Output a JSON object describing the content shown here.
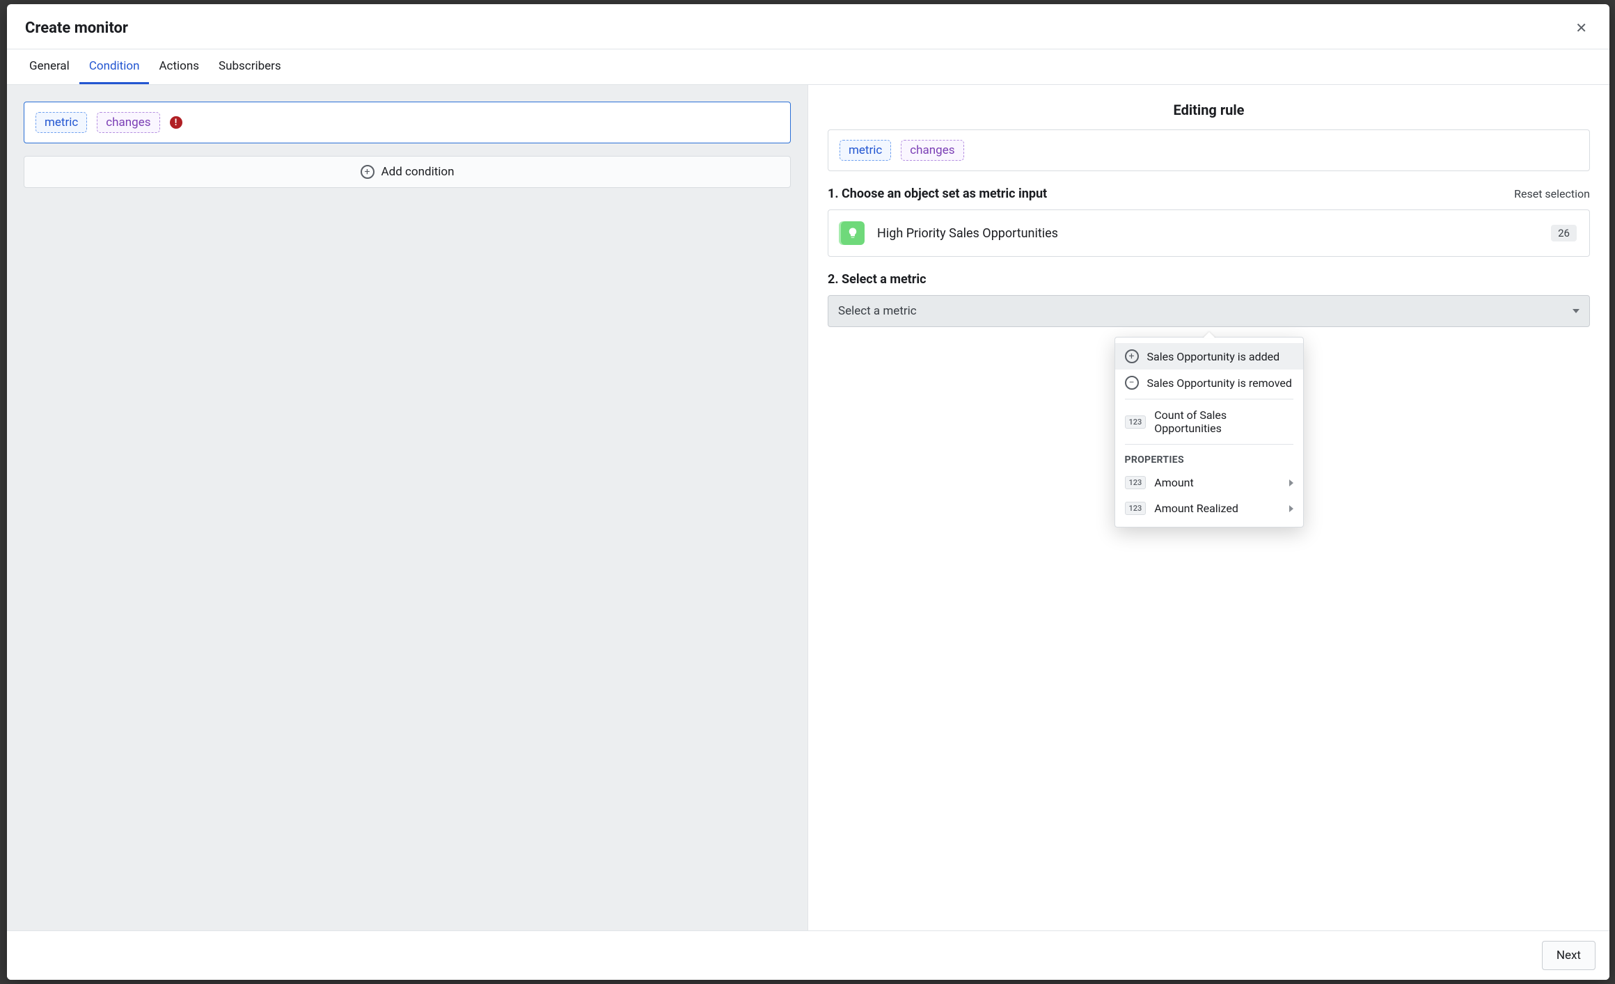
{
  "modal": {
    "title": "Create monitor"
  },
  "tabs": [
    {
      "label": "General",
      "active": false
    },
    {
      "label": "Condition",
      "active": true
    },
    {
      "label": "Actions",
      "active": false
    },
    {
      "label": "Subscribers",
      "active": false
    }
  ],
  "left": {
    "rule_pills": {
      "metric": "metric",
      "changes": "changes"
    },
    "add_condition": "Add condition"
  },
  "right": {
    "title": "Editing rule",
    "rule_pills": {
      "metric": "metric",
      "changes": "changes"
    },
    "step1_label": "1. Choose an object set as metric input",
    "reset": "Reset selection",
    "object_set": {
      "name": "High Priority Sales Opportunities",
      "count": "26"
    },
    "step2_label": "2. Select a metric",
    "select_placeholder": "Select a metric",
    "dropdown": {
      "items": [
        {
          "kind": "add",
          "label": "Sales Opportunity is added"
        },
        {
          "kind": "remove",
          "label": "Sales Opportunity is removed"
        }
      ],
      "count_item": {
        "label": "Count of Sales Opportunities"
      },
      "heading": "PROPERTIES",
      "properties": [
        {
          "label": "Amount"
        },
        {
          "label": "Amount Realized"
        }
      ]
    }
  },
  "footer": {
    "next": "Next"
  }
}
